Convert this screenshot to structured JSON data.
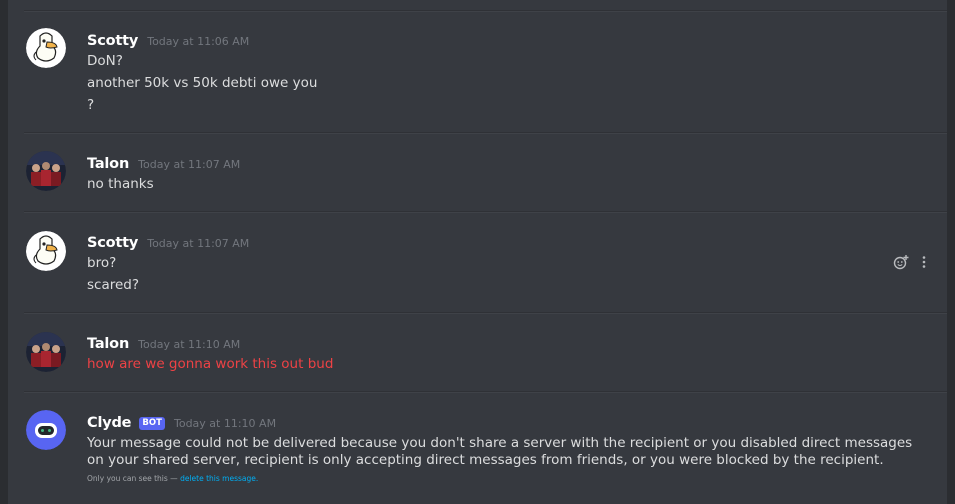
{
  "messages": [
    {
      "author": "Scotty",
      "timestamp": "Today at 11:06 AM",
      "lines": [
        "DoN?",
        "another 50k vs 50k debti owe you",
        "?"
      ]
    },
    {
      "author": "Talon",
      "timestamp": "Today at 11:07 AM",
      "lines": [
        "no thanks"
      ]
    },
    {
      "author": "Scotty",
      "timestamp": "Today at 11:07 AM",
      "lines": [
        "bro?",
        "scared?"
      ]
    },
    {
      "author": "Talon",
      "timestamp": "Today at 11:10 AM",
      "lines": [
        "how are we gonna work this out bud"
      ]
    },
    {
      "author": "Clyde",
      "bot_tag": "BOT",
      "timestamp": "Today at 11:10 AM",
      "text": "Your message could not be delivered because you don't share a server with the recipient or you disabled direct messages on your shared server, recipient is only accepting direct messages from friends, or you were blocked by the recipient.",
      "ephemeral_prefix": "Only you can see this —",
      "ephemeral_link": "delete this message."
    }
  ],
  "icons": {
    "avatar_scotty": "duck-avatar-icon",
    "avatar_talon": "group-photo-avatar-icon",
    "avatar_clyde": "clyde-bot-avatar-icon",
    "add_reaction": "add-reaction-icon",
    "more": "more-options-icon"
  },
  "colors": {
    "background": "#36393f",
    "failed_message": "#ed4245",
    "bot_tag": "#5865f2",
    "link": "#00aff4",
    "clyde_avatar": "#5865f2"
  }
}
